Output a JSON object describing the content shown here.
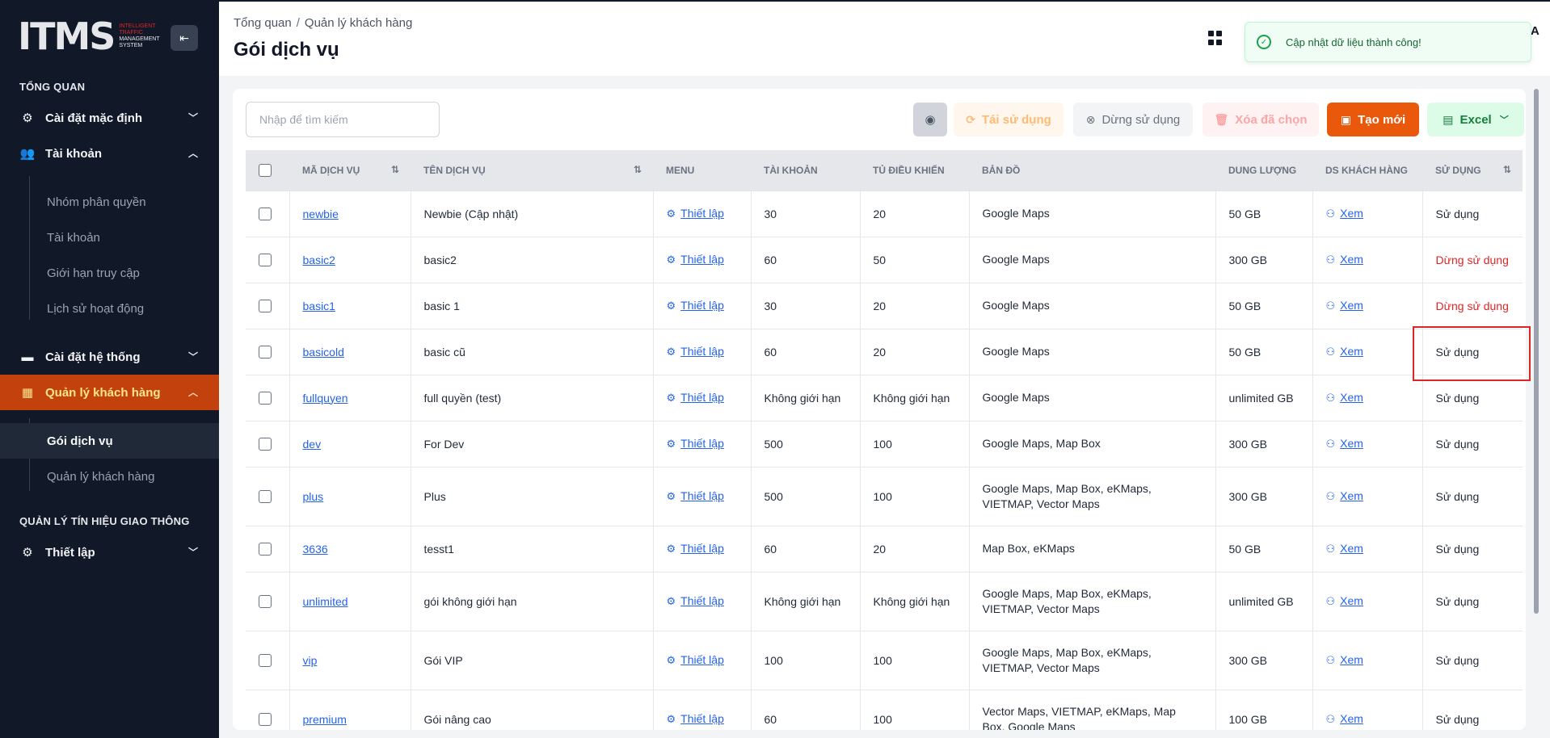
{
  "app": {
    "logo_text": "ITMS",
    "logo_sub": [
      "INTELLIGENT",
      "TRAFFIC",
      "MANAGEMENT",
      "SYSTEM"
    ]
  },
  "sidebar": {
    "section_overview": "TỔNG QUAN",
    "section_traffic": "QUẢN LÝ TÍN HIỆU GIAO THÔNG",
    "items": {
      "default_settings": "Cài đặt mặc định",
      "account": "Tài khoản",
      "system_settings": "Cài đặt hệ thống",
      "customer_management": "Quản lý khách hàng",
      "setup": "Thiết lập"
    },
    "account_sub": [
      "Nhóm phân quyền",
      "Tài khoản",
      "Giới hạn truy cập",
      "Lịch sử hoạt động"
    ],
    "customer_sub": [
      "Gói dịch vụ",
      "Quản lý khách hàng"
    ]
  },
  "header": {
    "breadcrumb": [
      "Tổng quan",
      "Quản lý khách hàng"
    ],
    "breadcrumb_sep": "/",
    "title": "Gói dịch vụ",
    "user_initial": "A"
  },
  "toast": {
    "message": "Cập nhật dữ liệu thành công!"
  },
  "toolbar": {
    "search_placeholder": "Nhập để tìm kiếm",
    "reuse_label": "Tái sử dụng",
    "stop_label": "Dừng sử dụng",
    "delete_label": "Xóa đã chọn",
    "create_label": "Tạo mới",
    "excel_label": "Excel"
  },
  "table": {
    "columns": [
      "MÃ DỊCH VỤ",
      "TÊN DỊCH VỤ",
      "MENU",
      "TÀI KHOẢN",
      "TỦ ĐIỀU KHIỂN",
      "BẢN ĐỒ",
      "DUNG LƯỢNG",
      "DS KHÁCH HÀNG",
      "SỬ DỤNG"
    ],
    "menu_link": "Thiết lập",
    "customers_link": "Xem",
    "rows": [
      {
        "code": "newbie",
        "name": "Newbie (Cập nhật)",
        "accounts": "30",
        "controllers": "20",
        "maps": [
          "Google Maps"
        ],
        "storage": "50 GB",
        "status": "Sử dụng",
        "active": true
      },
      {
        "code": "basic2",
        "name": "basic2",
        "accounts": "60",
        "controllers": "50",
        "maps": [
          "Google Maps"
        ],
        "storage": "300 GB",
        "status": "Dừng sử dụng",
        "active": false
      },
      {
        "code": "basic1",
        "name": "basic 1",
        "accounts": "30",
        "controllers": "20",
        "maps": [
          "Google Maps"
        ],
        "storage": "50 GB",
        "status": "Dừng sử dụng",
        "active": false
      },
      {
        "code": "basicold",
        "name": "basic cũ",
        "accounts": "60",
        "controllers": "20",
        "maps": [
          "Google Maps"
        ],
        "storage": "50 GB",
        "status": "Sử dụng",
        "active": true
      },
      {
        "code": "fullquyen",
        "name": "full quyền (test)",
        "accounts": "Không giới hạn",
        "controllers": "Không giới hạn",
        "maps": [
          "Google Maps"
        ],
        "storage": "unlimited GB",
        "status": "Sử dụng",
        "active": true
      },
      {
        "code": "dev",
        "name": "For Dev",
        "accounts": "500",
        "controllers": "100",
        "maps": [
          "Google Maps, Map Box"
        ],
        "storage": "300 GB",
        "status": "Sử dụng",
        "active": true
      },
      {
        "code": "plus",
        "name": "Plus",
        "accounts": "500",
        "controllers": "100",
        "maps": [
          "Google Maps, Map Box, eKMaps,",
          "VIETMAP, Vector Maps"
        ],
        "storage": "300 GB",
        "status": "Sử dụng",
        "active": true
      },
      {
        "code": "3636",
        "name": "tesst1",
        "accounts": "60",
        "controllers": "20",
        "maps": [
          "Map Box, eKMaps"
        ],
        "storage": "50 GB",
        "status": "Sử dụng",
        "active": true
      },
      {
        "code": "unlimited",
        "name": "gói không giới hạn",
        "accounts": "Không giới hạn",
        "controllers": "Không giới hạn",
        "maps": [
          "Google Maps, Map Box, eKMaps,",
          "VIETMAP, Vector Maps"
        ],
        "storage": "unlimited GB",
        "status": "Sử dụng",
        "active": true
      },
      {
        "code": "vip",
        "name": "Gói VIP",
        "accounts": "100",
        "controllers": "100",
        "maps": [
          "Google Maps, Map Box, eKMaps,",
          "VIETMAP, Vector Maps"
        ],
        "storage": "300 GB",
        "status": "Sử dụng",
        "active": true
      },
      {
        "code": "premium",
        "name": "Gói nâng cao",
        "accounts": "60",
        "controllers": "100",
        "maps": [
          "Vector Maps, VIETMAP, eKMaps, Map",
          "Box, Google Maps"
        ],
        "storage": "100 GB",
        "status": "Sử dụng",
        "active": true
      }
    ]
  },
  "colors": {
    "sidebar_bg": "#111827",
    "accent": "#ea580c",
    "link": "#2563eb",
    "danger": "#dc2626",
    "success": "#16a34a"
  }
}
